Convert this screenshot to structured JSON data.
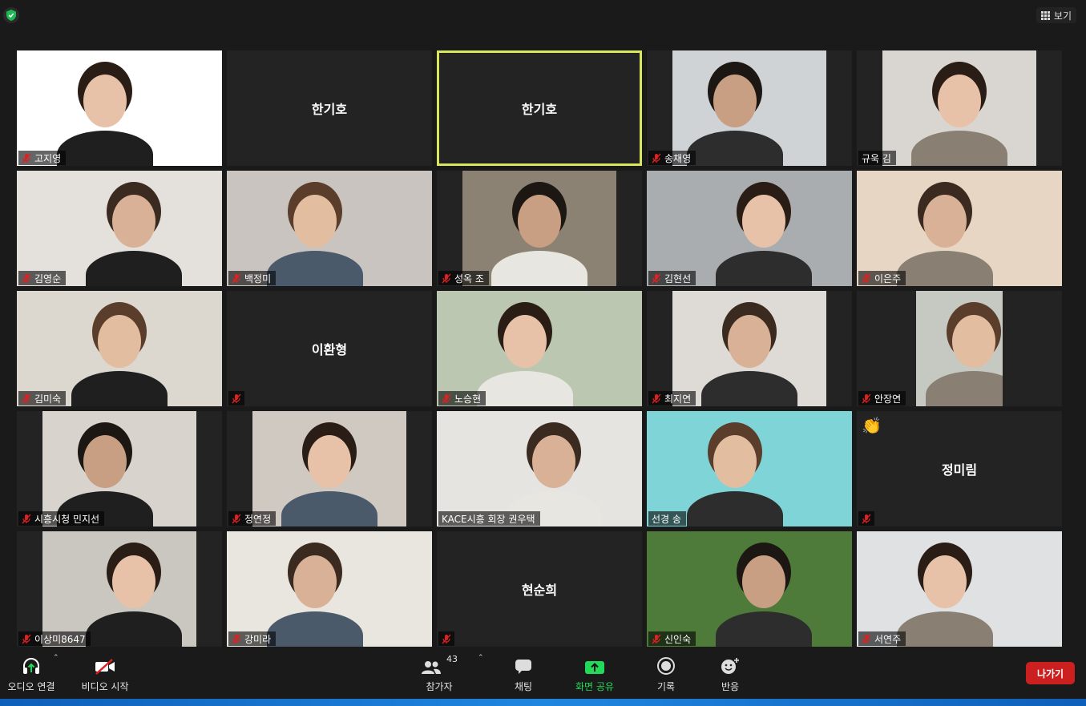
{
  "top": {
    "view_label": "보기"
  },
  "participants": [
    {
      "name": "고지영",
      "display": "video",
      "muted": true,
      "bg": "#ffffff"
    },
    {
      "name": "한기호",
      "display": "name",
      "muted": false,
      "bg": "#232323"
    },
    {
      "name": "한기호",
      "display": "name",
      "muted": false,
      "bg": "#232323",
      "active": true
    },
    {
      "name": "송채영",
      "display": "video",
      "muted": true,
      "bg": "#cfd3d6"
    },
    {
      "name": "규욱 김",
      "display": "video",
      "muted": false,
      "bg": "#d9d6d1"
    },
    {
      "name": "김영순",
      "display": "video",
      "muted": true,
      "bg": "#e4e1dc"
    },
    {
      "name": "백정미",
      "display": "video",
      "muted": true,
      "bg": "#c9c4bf"
    },
    {
      "name": "성옥 조",
      "display": "video",
      "muted": true,
      "bg": "#8b8273"
    },
    {
      "name": "김현선",
      "display": "video",
      "muted": true,
      "bg": "#a9adaf"
    },
    {
      "name": "이은주",
      "display": "video",
      "muted": true,
      "bg": "#e7d6c4"
    },
    {
      "name": "김미숙",
      "display": "video",
      "muted": true,
      "bg": "#dcd8d0"
    },
    {
      "name": "이환형",
      "display": "name",
      "muted": true,
      "bg": "#232323"
    },
    {
      "name": "노승현",
      "display": "video",
      "muted": true,
      "bg": "#bcc7b2"
    },
    {
      "name": "최지연",
      "display": "video",
      "muted": true,
      "bg": "#dedbd6"
    },
    {
      "name": "안장연",
      "display": "video",
      "muted": true,
      "bg": "#c5c9c2"
    },
    {
      "name": "시흥시청 민지선",
      "display": "video",
      "muted": true,
      "bg": "#d8d3cc"
    },
    {
      "name": "정연정",
      "display": "video",
      "muted": true,
      "bg": "#cfc9c2"
    },
    {
      "name": "KACE시흥 회장 권우택",
      "display": "video",
      "muted": false,
      "bg": "#e5e4e0"
    },
    {
      "name": "선경 송",
      "display": "video",
      "muted": false,
      "bg": "#7fd4d8"
    },
    {
      "name": "정미림",
      "display": "name",
      "muted": true,
      "bg": "#232323",
      "reaction": "👏"
    },
    {
      "name": "이상미8647",
      "display": "video",
      "muted": true,
      "bg": "#cac6c0"
    },
    {
      "name": "강미라",
      "display": "video",
      "muted": true,
      "bg": "#e9e5df"
    },
    {
      "name": "현순희",
      "display": "name",
      "muted": true,
      "bg": "#232323"
    },
    {
      "name": "신인숙",
      "display": "video",
      "muted": true,
      "bg": "#4e7a3a"
    },
    {
      "name": "서연주",
      "display": "video",
      "muted": true,
      "bg": "#dfe1e3"
    }
  ],
  "toolbar": {
    "audio": "오디오 연결",
    "video": "비디오 시작",
    "participants": "참가자",
    "participant_count": "43",
    "chat": "채팅",
    "share": "화면 공유",
    "record": "기록",
    "reactions": "반응",
    "leave": "나가기"
  },
  "colors": {
    "share_green": "#23d959",
    "leave_red": "#cc1f1f",
    "active_border": "#d8e85a"
  }
}
